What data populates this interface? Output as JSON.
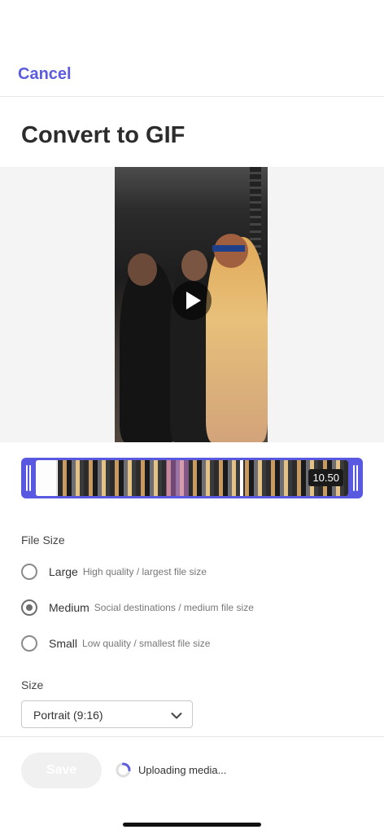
{
  "header": {
    "cancel_label": "Cancel"
  },
  "page": {
    "title": "Convert to GIF"
  },
  "trimmer": {
    "duration": "10.50"
  },
  "file_size": {
    "label": "File Size",
    "options": [
      {
        "title": "Large",
        "desc": "High quality / largest file size",
        "checked": false
      },
      {
        "title": "Medium",
        "desc": "Social destinations / medium file size",
        "checked": true
      },
      {
        "title": "Small",
        "desc": "Low quality / smallest file size",
        "checked": false
      }
    ]
  },
  "size": {
    "label": "Size",
    "selected": "Portrait (9:16)"
  },
  "footer": {
    "save_label": "Save",
    "status": "Uploading media..."
  },
  "colors": {
    "accent": "#5c5ce0",
    "trim": "#5858e0"
  }
}
